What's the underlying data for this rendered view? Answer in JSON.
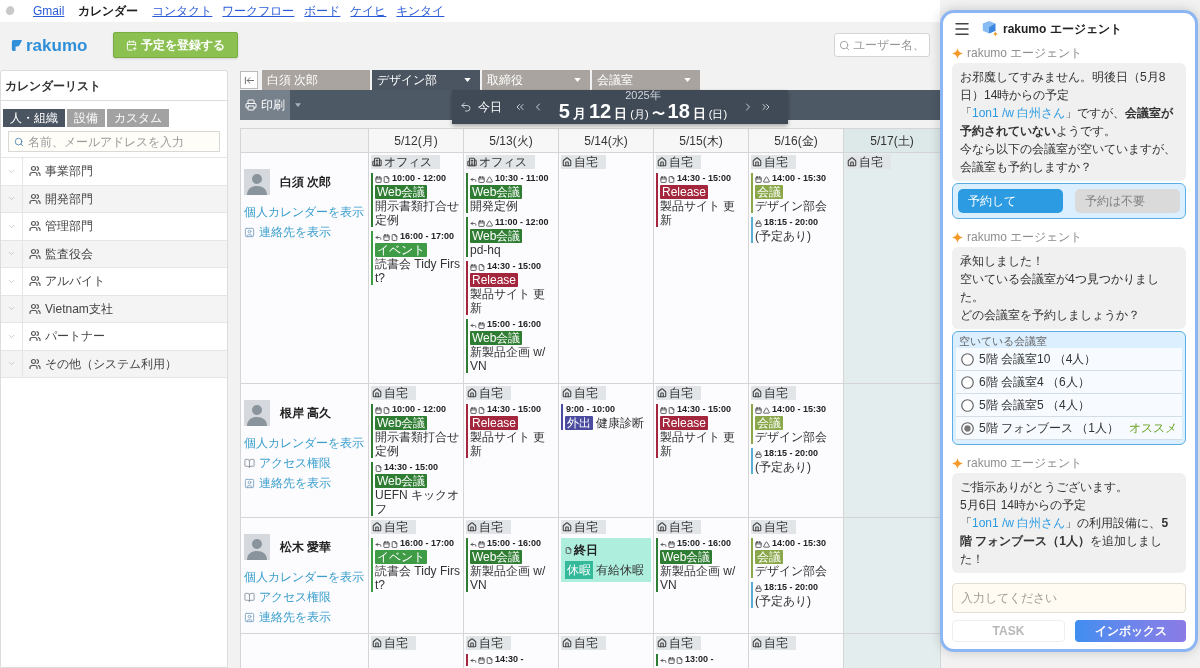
{
  "top_nav": {
    "links": [
      {
        "label": "Gmail",
        "selected": false
      },
      {
        "label": "カレンダー",
        "selected": true
      },
      {
        "label": "コンタクト",
        "selected": false
      },
      {
        "label": "ワークフロー",
        "selected": false
      },
      {
        "label": "ボード",
        "selected": false
      },
      {
        "label": "ケイヒ",
        "selected": false
      },
      {
        "label": "キンタイ",
        "selected": false
      }
    ]
  },
  "header": {
    "brand": "rakumo",
    "create_button": "予定を登録する",
    "search": {
      "placeholder": "ユーザー名、"
    }
  },
  "sidebar": {
    "title": "カレンダーリスト",
    "tabs": [
      {
        "label": "人・組織",
        "selected": true
      },
      {
        "label": "設備",
        "selected": false
      },
      {
        "label": "カスタム",
        "selected": false
      }
    ],
    "search": {
      "placeholder": "名前、メールアドレスを入力"
    },
    "groups": [
      "事業部門",
      "開発部門",
      "管理部門",
      "監査役会",
      "アルバイト",
      "Vietnam支社",
      "パートナー",
      "その他（システム利用）"
    ]
  },
  "calendar": {
    "tabs": [
      {
        "label": "白須 次郎",
        "dropdown": false,
        "selected": false
      },
      {
        "label": "デザイン部",
        "dropdown": true,
        "selected": true
      },
      {
        "label": "取締役",
        "dropdown": true,
        "selected": false
      },
      {
        "label": "会議室",
        "dropdown": true,
        "selected": false
      }
    ],
    "print_button": "印刷",
    "navigator": {
      "today": "今日",
      "year": "2025年",
      "range": [
        {
          "kind": "number",
          "text": "5"
        },
        {
          "kind": "unit",
          "text": "月"
        },
        {
          "kind": "number",
          "text": "12"
        },
        {
          "kind": "unit",
          "text": "日"
        },
        {
          "kind": "weekday",
          "text": "(月)"
        },
        {
          "kind": "unit",
          "text": "〜"
        },
        {
          "kind": "number",
          "text": "18"
        },
        {
          "kind": "unit",
          "text": "日"
        },
        {
          "kind": "weekday",
          "text": "(日)"
        }
      ]
    },
    "days": [
      {
        "label": "5/12(月)",
        "weekend": false
      },
      {
        "label": "5/13(火)",
        "weekend": false
      },
      {
        "label": "5/14(水)",
        "weekend": false
      },
      {
        "label": "5/15(木)",
        "weekend": false
      },
      {
        "label": "5/16(金)",
        "weekend": false
      },
      {
        "label": "5/17(土)",
        "weekend": true
      }
    ],
    "people": [
      {
        "name": "白須 次郎",
        "links": [
          {
            "kind": "calendar",
            "label": "個人カレンダーを表示"
          },
          {
            "kind": "contact",
            "label": "連絡先を表示"
          }
        ],
        "cells": [
          {
            "location": {
              "kind": "office",
              "label": "オフィス"
            },
            "events": [
              {
                "kind": "timed",
                "reply": false,
                "calendar": true,
                "doc": true,
                "drive": false,
                "lock": false,
                "time": "10:00 - 12:00",
                "tag": "Web会議",
                "color": "#2e7d32",
                "title": "開示書類打合せ定例"
              },
              {
                "kind": "timed",
                "reply": true,
                "calendar": true,
                "doc": true,
                "drive": false,
                "lock": false,
                "time": "16:00 - 17:00",
                "tag": "イベント",
                "color": "#3f9b45",
                "title": "読書会 Tidy First?"
              }
            ]
          },
          {
            "location": {
              "kind": "office",
              "label": "オフィス"
            },
            "events": [
              {
                "kind": "timed",
                "reply": true,
                "calendar": true,
                "doc": false,
                "drive": true,
                "lock": false,
                "time": "10:30 - 11:00",
                "tag": "Web会議",
                "color": "#2e7d32",
                "title": "開発定例"
              },
              {
                "kind": "timed",
                "reply": true,
                "calendar": true,
                "doc": false,
                "drive": true,
                "lock": false,
                "time": "11:00 - 12:00",
                "tag": "Web会議",
                "color": "#2e7d32",
                "title": "pd-hq"
              },
              {
                "kind": "timed",
                "reply": false,
                "calendar": true,
                "doc": true,
                "drive": false,
                "lock": false,
                "time": "14:30 - 15:00",
                "tag": "Release",
                "color": "#a3263c",
                "title": "製品サイト 更新"
              },
              {
                "kind": "timed",
                "reply": true,
                "calendar": true,
                "doc": false,
                "drive": false,
                "lock": false,
                "time": "15:00 - 16:00",
                "tag": "Web会議",
                "color": "#2e7d32",
                "title": "新製品企画 w/ VN"
              }
            ]
          },
          {
            "location": {
              "kind": "home",
              "label": "自宅"
            }
          },
          {
            "location": {
              "kind": "home",
              "label": "自宅"
            },
            "events": [
              {
                "kind": "timed",
                "reply": false,
                "calendar": true,
                "doc": true,
                "drive": false,
                "lock": false,
                "time": "14:30 - 15:00",
                "tag": "Release",
                "color": "#a3263c",
                "title": "製品サイト 更新"
              }
            ]
          },
          {
            "location": {
              "kind": "home",
              "label": "自宅"
            },
            "events": [
              {
                "kind": "timed",
                "reply": false,
                "calendar": true,
                "doc": false,
                "drive": true,
                "lock": false,
                "time": "14:00 - 15:30",
                "tag": "会議",
                "color": "#8aa84a",
                "title": "デザイン部会"
              },
              {
                "kind": "timed",
                "reply": false,
                "calendar": false,
                "doc": false,
                "drive": false,
                "lock": true,
                "time": "18:15 - 20:00",
                "color": "#5aaed0",
                "title": "(予定あり)"
              }
            ]
          },
          {
            "location": {
              "kind": "home",
              "label": "自宅"
            }
          }
        ]
      },
      {
        "name": "根岸 高久",
        "links": [
          {
            "kind": "calendar",
            "label": "個人カレンダーを表示"
          },
          {
            "kind": "access",
            "label": "アクセス権限"
          },
          {
            "kind": "contact",
            "label": "連絡先を表示"
          }
        ],
        "cells": [
          {
            "location": {
              "kind": "home",
              "label": "自宅"
            },
            "events": [
              {
                "kind": "timed",
                "reply": false,
                "calendar": true,
                "doc": true,
                "drive": false,
                "lock": false,
                "time": "10:00 - 12:00",
                "tag": "Web会議",
                "color": "#2e7d32",
                "title": "開示書類打合せ定例"
              },
              {
                "kind": "timed",
                "reply": false,
                "calendar": false,
                "doc": true,
                "drive": false,
                "lock": false,
                "time": "14:30 - 15:00",
                "tag": "Web会議",
                "color": "#2e7d32",
                "title": "UEFN キックオフ"
              }
            ]
          },
          {
            "location": {
              "kind": "home",
              "label": "自宅"
            },
            "events": [
              {
                "kind": "timed",
                "reply": false,
                "calendar": true,
                "doc": true,
                "drive": false,
                "lock": false,
                "time": "14:30 - 15:00",
                "tag": "Release",
                "color": "#a3263c",
                "title": "製品サイト 更新"
              }
            ]
          },
          {
            "location": {
              "kind": "home",
              "label": "自宅"
            },
            "events": [
              {
                "kind": "timed",
                "reply": false,
                "calendar": false,
                "doc": false,
                "drive": false,
                "lock": false,
                "time": "9:00 - 10:00",
                "tag": "外出",
                "color": "#4b4ba0",
                "title": "健康診断"
              }
            ]
          },
          {
            "location": {
              "kind": "home",
              "label": "自宅"
            },
            "events": [
              {
                "kind": "timed",
                "reply": false,
                "calendar": true,
                "doc": true,
                "drive": false,
                "lock": false,
                "time": "14:30 - 15:00",
                "tag": "Release",
                "color": "#a3263c",
                "title": "製品サイト 更新"
              }
            ]
          },
          {
            "location": {
              "kind": "home",
              "label": "自宅"
            },
            "events": [
              {
                "kind": "timed",
                "reply": false,
                "calendar": true,
                "doc": false,
                "drive": true,
                "lock": false,
                "time": "14:00 - 15:30",
                "tag": "会議",
                "color": "#8aa84a",
                "title": "デザイン部会"
              },
              {
                "kind": "timed",
                "reply": false,
                "calendar": false,
                "doc": false,
                "drive": false,
                "lock": true,
                "time": "18:15 - 20:00",
                "color": "#5aaed0",
                "title": "(予定あり)"
              }
            ]
          }
        ]
      },
      {
        "name": "松木 愛華",
        "links": [
          {
            "kind": "calendar",
            "label": "個人カレンダーを表示"
          },
          {
            "kind": "access",
            "label": "アクセス権限"
          },
          {
            "kind": "contact",
            "label": "連絡先を表示"
          }
        ],
        "cells": [
          {
            "location": {
              "kind": "home",
              "label": "自宅"
            },
            "events": [
              {
                "kind": "timed",
                "reply": true,
                "calendar": true,
                "doc": true,
                "drive": false,
                "lock": false,
                "time": "16:00 - 17:00",
                "tag": "イベント",
                "color": "#3f9b45",
                "title": "読書会 Tidy First?"
              }
            ]
          },
          {
            "location": {
              "kind": "home",
              "label": "自宅"
            },
            "events": [
              {
                "kind": "timed",
                "reply": true,
                "calendar": true,
                "doc": false,
                "drive": false,
                "lock": false,
                "time": "15:00 - 16:00",
                "tag": "Web会議",
                "color": "#2e7d32",
                "title": "新製品企画 w/ VN"
              }
            ]
          },
          {
            "location": {
              "kind": "home",
              "label": "自宅"
            },
            "events": [
              {
                "kind": "allday",
                "reply": false,
                "calendar": false,
                "doc": true,
                "drive": false,
                "lock": false,
                "time": "終日",
                "tag": "休暇",
                "color": "#35b99b",
                "title": "有給休暇"
              }
            ]
          },
          {
            "location": {
              "kind": "home",
              "label": "自宅"
            },
            "events": [
              {
                "kind": "timed",
                "reply": true,
                "calendar": true,
                "doc": false,
                "drive": false,
                "lock": false,
                "time": "15:00 - 16:00",
                "tag": "Web会議",
                "color": "#2e7d32",
                "title": "新製品企画 w/ VN"
              }
            ]
          },
          {
            "location": {
              "kind": "home",
              "label": "自宅"
            },
            "events": [
              {
                "kind": "timed",
                "reply": false,
                "calendar": true,
                "doc": false,
                "drive": true,
                "lock": false,
                "time": "14:00 - 15:30",
                "tag": "会議",
                "color": "#8aa84a",
                "title": "デザイン部会"
              },
              {
                "kind": "timed",
                "reply": false,
                "calendar": false,
                "doc": false,
                "drive": false,
                "lock": true,
                "time": "18:15 - 20:00",
                "color": "#5aaed0",
                "title": "(予定あり)"
              }
            ]
          }
        ]
      },
      {
        "cells": [
          {
            "location": {
              "kind": "home",
              "label": "自宅"
            }
          },
          {
            "location": {
              "kind": "home",
              "label": "自宅"
            },
            "events": [
              {
                "kind": "timed",
                "reply": true,
                "calendar": true,
                "doc": true,
                "drive": false,
                "lock": false,
                "time": "14:30 -",
                "color": "#a3263c"
              }
            ]
          },
          {
            "location": {
              "kind": "home",
              "label": "自宅"
            }
          },
          {
            "location": {
              "kind": "home",
              "label": "自宅"
            },
            "events": [
              {
                "kind": "timed",
                "reply": true,
                "calendar": true,
                "doc": true,
                "drive": false,
                "lock": false,
                "time": "13:00 -",
                "color": "#2e7d32"
              }
            ]
          },
          {
            "location": {
              "kind": "home",
              "label": "自宅"
            }
          }
        ]
      }
    ]
  },
  "agent_panel": {
    "title": "rakumo エージェント",
    "messages": [
      {
        "sender": "rakumo エージェント",
        "paragraphs": [
          {
            "parts": [
              {
                "kind": "text",
                "text": "お邪魔してすみません。明後日（5月8日）14時からの予定「"
              },
              {
                "kind": "link",
                "text": "1on1 /w 白州さん"
              },
              {
                "kind": "text",
                "text": "」ですが、**会議室が予約されていない**ようです。"
              }
            ]
          },
          {
            "parts": [
              {
                "kind": "text",
                "text": "今なら以下の会議室が空いていますが、会議室も予約しますか？"
              }
            ]
          }
        ],
        "actions": [
          {
            "label": "予約して",
            "selected": true
          },
          {
            "label": "予約は不要",
            "selected": false
          }
        ]
      },
      {
        "sender": "rakumo エージェント",
        "paragraphs": [
          {
            "parts": [
              {
                "kind": "text",
                "text": "承知しました！"
              }
            ]
          },
          {
            "parts": [
              {
                "kind": "text",
                "text": "空いている会議室が4つ見つかりました。"
              }
            ]
          },
          {
            "parts": [
              {
                "kind": "text",
                "text": "どの会議室を予約しましょうか？"
              }
            ]
          }
        ],
        "rooms": {
          "caption": "空いている会議室",
          "options": [
            {
              "label": "5階 会議室10 （4人）",
              "selected": false
            },
            {
              "label": "6階 会議室4 （6人）",
              "selected": false
            },
            {
              "label": "5階 会議室5 （4人）",
              "selected": false
            },
            {
              "label": "5階 フォンブース （1人）",
              "selected": true,
              "badge": "オススメ"
            }
          ]
        }
      },
      {
        "sender": "rakumo エージェント",
        "paragraphs": [
          {
            "parts": [
              {
                "kind": "text",
                "text": "ご指示ありがとうございます。"
              }
            ]
          },
          {
            "parts": [
              {
                "kind": "text",
                "text": "5月6日 14時からの予定「"
              },
              {
                "kind": "link",
                "text": "1on1 /w 白州さん"
              },
              {
                "kind": "text",
                "text": "」の利用設備に、**5階 フォンブース（1人）**を追加しました！"
              }
            ]
          }
        ]
      }
    ],
    "input": {
      "placeholder": "入力してください"
    },
    "tabs": [
      {
        "label": "TASK",
        "selected": false
      },
      {
        "label": "インボックス",
        "selected": true
      }
    ]
  }
}
